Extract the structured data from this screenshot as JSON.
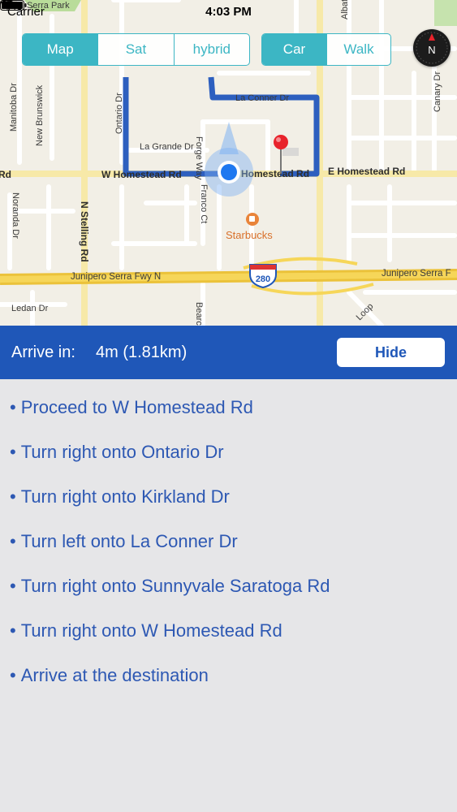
{
  "status_bar": {
    "carrier": "Carrier",
    "time": "4:03 PM"
  },
  "map": {
    "map_type_options": [
      {
        "label": "Map",
        "selected": true
      },
      {
        "label": "Sat",
        "selected": false
      },
      {
        "label": "hybrid",
        "selected": false
      }
    ],
    "travel_mode_options": [
      {
        "label": "Car",
        "selected": true
      },
      {
        "label": "Walk",
        "selected": false
      }
    ],
    "compass_letter": "N",
    "labels": {
      "serra_park": "Serra Park",
      "albat": "Albat",
      "canary_dr": "Canary Dr",
      "la_conner_dr": "La Conner Dr",
      "ontario_dr": "Ontario Dr",
      "manitoba_dr": "Manitoba Dr",
      "new_brunswick": "New Brunswick",
      "la_grande_dr": "La Grande Dr",
      "forge_way": "Forge Way",
      "w_homestead_rd": "W Homestead Rd",
      "homestead_rd_mid": "Homestead Rd",
      "e_homestead_rd": "E Homestead Rd",
      "rd_left": "Rd",
      "noranda_dr": "Noranda Dr",
      "n_stelling_rd": "N Stelling Rd",
      "franco_ct": "Franco Ct",
      "starbucks": "Starbucks",
      "junipero_serra_fwy_n": "Junipero Serra Fwy N",
      "junipero_serra_right": "Junipero Serra F",
      "interstate_280": "280",
      "ledan_dr": "Ledan Dr",
      "bearc": "Bearc",
      "loop": "Loop"
    },
    "colors": {
      "route": "#2d5fbf",
      "user_location": "#1e78f0",
      "highway": "#f0c93b",
      "destination_pin": "#e8232b",
      "accent": "#3cb6c4"
    }
  },
  "arrival": {
    "label": "Arrive in:",
    "value": "4m (1.81km)",
    "hide_label": "Hide"
  },
  "directions": [
    "Proceed to W Homestead Rd",
    "Turn right onto Ontario Dr",
    "Turn right onto Kirkland Dr",
    "Turn left onto La Conner Dr",
    "Turn right onto Sunnyvale Saratoga Rd",
    "Turn right onto W Homestead Rd",
    "Arrive at the destination"
  ],
  "bullet": "•"
}
